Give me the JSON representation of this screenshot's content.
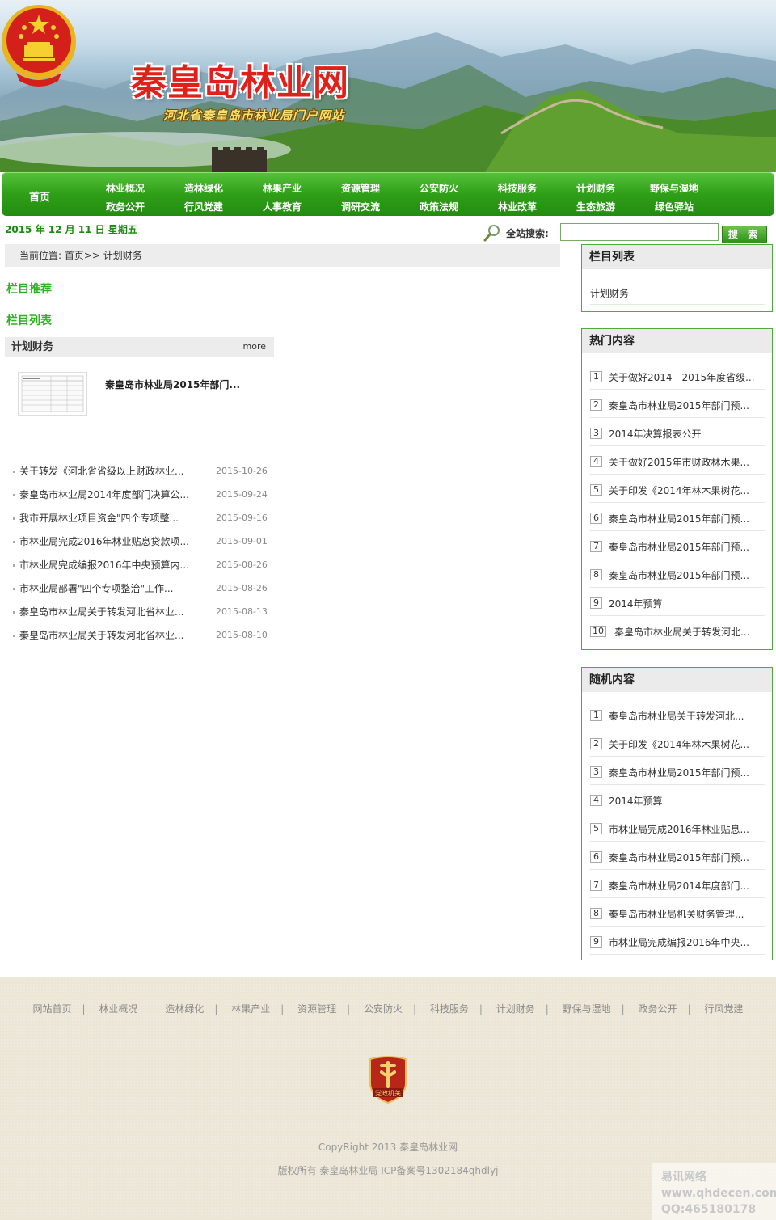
{
  "header": {
    "site_title": "秦皇岛林业网",
    "site_subtitle": "河北省秦皇岛市林业局门户网站"
  },
  "nav": {
    "home": "首页",
    "columns": [
      [
        "林业概况",
        "政务公开"
      ],
      [
        "造林绿化",
        "行风党建"
      ],
      [
        "林果产业",
        "人事教育"
      ],
      [
        "资源管理",
        "调研交流"
      ],
      [
        "公安防火",
        "政策法规"
      ],
      [
        "科技服务",
        "林业改革"
      ],
      [
        "计划财务",
        "生态旅游"
      ],
      [
        "野保与湿地",
        "绿色驿站"
      ]
    ]
  },
  "date_text": "2015 年 12 月 11 日 星期五",
  "search": {
    "label": "全站搜索:",
    "value": "",
    "button": "搜 索"
  },
  "breadcrumb": "当前位置: 首页>> 计划财务",
  "main": {
    "recommend_title": "栏目推荐",
    "list_title": "栏目列表",
    "box_title": "计划财务",
    "box_more": "more",
    "featured_title": "秦皇岛市林业局2015年部门...",
    "articles": [
      {
        "title": "关于转发《河北省省级以上财政林业...",
        "date": "2015-10-26"
      },
      {
        "title": "秦皇岛市林业局2014年度部门决算公...",
        "date": "2015-09-24"
      },
      {
        "title": "我市开展林业项目资金\"四个专项整...",
        "date": "2015-09-16"
      },
      {
        "title": "市林业局完成2016年林业贴息贷款项...",
        "date": "2015-09-01"
      },
      {
        "title": "市林业局完成编报2016年中央预算内...",
        "date": "2015-08-26"
      },
      {
        "title": "市林业局部署\"四个专项整治\"工作...",
        "date": "2015-08-26"
      },
      {
        "title": "秦皇岛市林业局关于转发河北省林业...",
        "date": "2015-08-13"
      },
      {
        "title": "秦皇岛市林业局关于转发河北省林业...",
        "date": "2015-08-10"
      }
    ]
  },
  "sidebar": {
    "column_list": {
      "title": "栏目列表",
      "items": [
        "计划财务"
      ]
    },
    "hot": {
      "title": "热门内容",
      "items": [
        {
          "n": "1",
          "t": "关于做好2014—2015年度省级..."
        },
        {
          "n": "2",
          "t": "秦皇岛市林业局2015年部门预..."
        },
        {
          "n": "3",
          "t": "2014年决算报表公开"
        },
        {
          "n": "4",
          "t": "关于做好2015年市财政林木果..."
        },
        {
          "n": "5",
          "t": "关于印发《2014年林木果树花..."
        },
        {
          "n": "6",
          "t": "秦皇岛市林业局2015年部门预..."
        },
        {
          "n": "7",
          "t": "秦皇岛市林业局2015年部门预..."
        },
        {
          "n": "8",
          "t": "秦皇岛市林业局2015年部门预..."
        },
        {
          "n": "9",
          "t": "2014年预算"
        },
        {
          "n": "10",
          "t": "秦皇岛市林业局关于转发河北..."
        }
      ]
    },
    "random": {
      "title": "随机内容",
      "items": [
        {
          "n": "1",
          "t": "秦皇岛市林业局关于转发河北..."
        },
        {
          "n": "2",
          "t": "关于印发《2014年林木果树花..."
        },
        {
          "n": "3",
          "t": "秦皇岛市林业局2015年部门预..."
        },
        {
          "n": "4",
          "t": "2014年预算"
        },
        {
          "n": "5",
          "t": "市林业局完成2016年林业贴息..."
        },
        {
          "n": "6",
          "t": "秦皇岛市林业局2015年部门预..."
        },
        {
          "n": "7",
          "t": "秦皇岛市林业局2014年度部门..."
        },
        {
          "n": "8",
          "t": "秦皇岛市林业局机关财务管理..."
        },
        {
          "n": "9",
          "t": "市林业局完成编报2016年中央..."
        }
      ]
    }
  },
  "footer": {
    "links": [
      "网站首页",
      "林业概况",
      "造林绿化",
      "林果产业",
      "资源管理",
      "公安防火",
      "科技服务",
      "计划财务",
      "野保与湿地",
      "政务公开",
      "行风党建"
    ],
    "badge_text": "党政机关",
    "copyright": "CopyRight 2013 秦皇岛林业网",
    "records": "版权所有 秦皇岛林业局   ICP备案号1302184qhdlyj"
  },
  "watermark": [
    "易讯网络",
    "www.qhdecen.com",
    "QQ:465180178"
  ],
  "colors": {
    "nav_green": "#2f9f18",
    "accent_green": "#2bb420",
    "title_red": "#e0201a"
  }
}
